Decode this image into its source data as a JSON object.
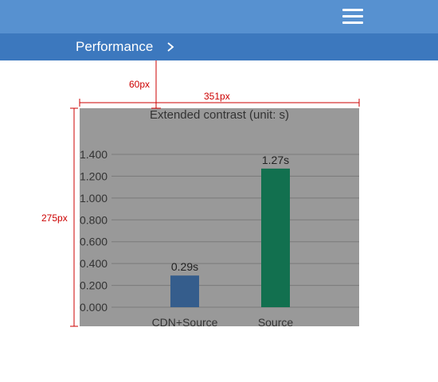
{
  "header": {
    "menu_icon": "hamburger-menu-icon",
    "breadcrumb_label": "Performance",
    "chevron_icon": "chevron-right-icon"
  },
  "annotations": {
    "offset_label": "60px",
    "width_label": "351px",
    "height_label": "275px",
    "color": "#cc0000"
  },
  "chart_data": {
    "type": "bar",
    "title": "Extended contrast (unit: s)",
    "categories": [
      "CDN+Source",
      "Source"
    ],
    "values": [
      0.29,
      1.27
    ],
    "data_labels": [
      "0.29s",
      "1.27s"
    ],
    "colors": [
      "#355d8c",
      "#12704f"
    ],
    "background": "#999999",
    "ylim": [
      0,
      1.4
    ],
    "yticks": [
      0.0,
      0.2,
      0.4,
      0.6,
      0.8,
      1.0,
      1.2,
      1.4
    ],
    "ytick_labels": [
      "0.000",
      "0.200",
      "0.400",
      "0.600",
      "0.800",
      "1.000",
      "1.200",
      "1.400"
    ],
    "grid": true,
    "xlabel": "",
    "ylabel": ""
  }
}
